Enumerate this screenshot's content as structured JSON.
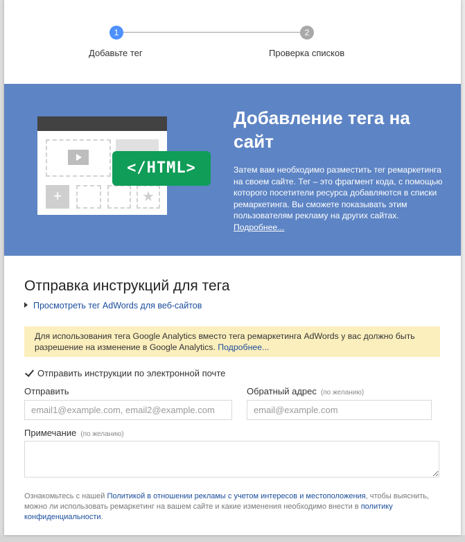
{
  "stepper": {
    "step1": {
      "number": "1",
      "label": "Добавьте тег"
    },
    "step2": {
      "number": "2",
      "label": "Проверка списков"
    }
  },
  "hero": {
    "title": "Добавление тега на сайт",
    "description": "Затем вам необходимо разместить тег ремаркетинга на своем сайте. Тег – это фрагмент кода, с помощью которого посетители ресурса добавляются в списки ремаркетинга. Вы сможете показывать этим пользователям рекламу на других сайтах.",
    "more_link": "Подробнее...",
    "badge": "</HTML>",
    "background_color": "#5d84c4",
    "badge_color": "#0f9d58"
  },
  "form": {
    "section_title": "Отправка инструкций для тега",
    "expander_link": "Просмотреть тег AdWords для веб-сайтов",
    "notice_text": "Для использования тега Google Analytics вместо тега ремаркетинга AdWords у вас должно быть разрешение на изменение в Google Analytics.",
    "notice_link": "Подробнее...",
    "email_checkbox_label": "Отправить инструкции по электронной почте",
    "email_checkbox_checked": true,
    "to_label": "Отправить",
    "to_placeholder": "email1@example.com, email2@example.com",
    "reply_label": "Обратный адрес",
    "reply_optional": "(по желанию)",
    "reply_placeholder": "email@example.com",
    "note_label": "Примечание",
    "note_optional": "(по желанию)"
  },
  "footer": {
    "text_before": "Ознакомьтесь с нашей ",
    "policy_link": "Политикой в отношении рекламы с учетом интересов и местоположения",
    "text_middle": ", чтобы выяснить, можно ли использовать ремаркетинг на вашем сайте и какие изменения необходимо внести в ",
    "privacy_link": "политику конфиденциальности",
    "text_after": "."
  }
}
